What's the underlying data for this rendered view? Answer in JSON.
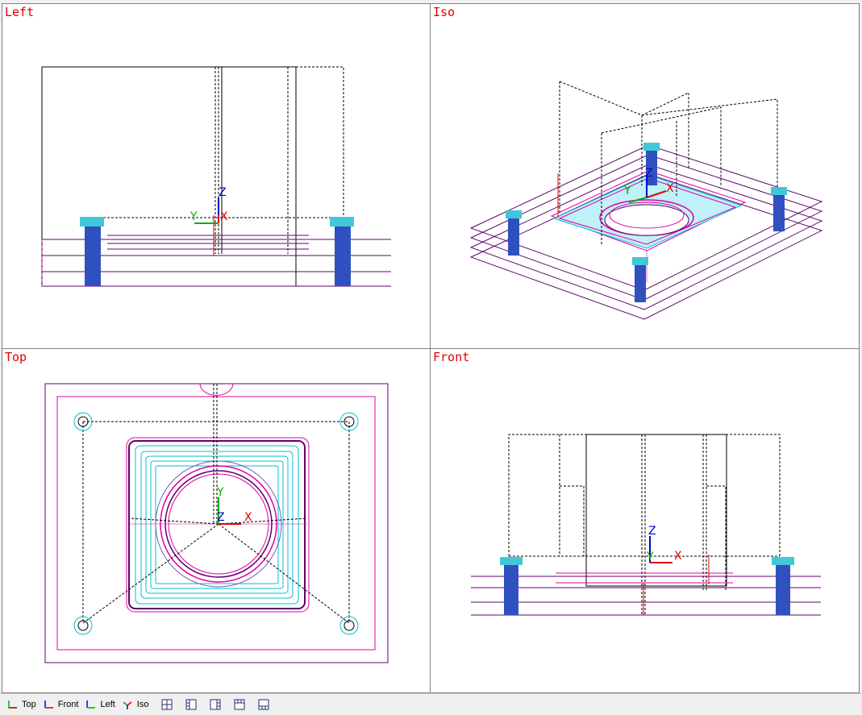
{
  "viewports": {
    "left": {
      "title": "Left"
    },
    "iso": {
      "title": "Iso"
    },
    "top": {
      "title": "Top"
    },
    "front": {
      "title": "Front"
    }
  },
  "axes": {
    "x": "X",
    "y": "Y",
    "z": "Z"
  },
  "toolbar": {
    "tabs": [
      {
        "label": "Top"
      },
      {
        "label": "Front"
      },
      {
        "label": "Left"
      },
      {
        "label": "Iso"
      }
    ],
    "layout_buttons": [
      "layout-quad-icon",
      "layout-left-split-icon",
      "layout-right-split-icon",
      "layout-top-split-icon",
      "layout-bottom-split-icon"
    ]
  },
  "colors": {
    "title": "#e00000",
    "axis_x": "#e00000",
    "axis_y": "#00b000",
    "axis_z": "#0000cc",
    "plate": "#600070",
    "toolpath": "#e000a0",
    "cyan": "#00c0d0",
    "bolt": "#3050c0"
  }
}
